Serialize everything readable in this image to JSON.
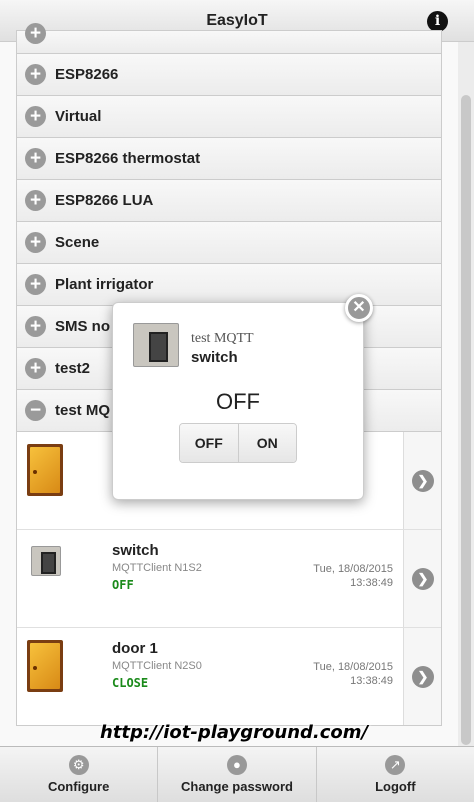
{
  "header": {
    "title": "EasyIoT",
    "info_icon": "info-icon"
  },
  "categories": [
    {
      "label": ""
    },
    {
      "label": "ESP8266"
    },
    {
      "label": "Virtual"
    },
    {
      "label": "ESP8266 thermostat"
    },
    {
      "label": "ESP8266 LUA"
    },
    {
      "label": "Scene"
    },
    {
      "label": "Plant irrigator"
    },
    {
      "label": "SMS no"
    },
    {
      "label": "test2"
    },
    {
      "label": "test MQ"
    }
  ],
  "devices": [
    {
      "icon": "door-icon",
      "name": "",
      "client": "",
      "state": "",
      "time1": "",
      "time2": ""
    },
    {
      "icon": "switch-icon",
      "name": "switch",
      "client": "MQTTClient N1S2",
      "state": "OFF",
      "time1": "Tue, 18/08/2015",
      "time2": "13:38:49"
    },
    {
      "icon": "door-icon",
      "name": "door 1",
      "client": "MQTTClient N2S0",
      "state": "CLOSE",
      "time1": "Tue, 18/08/2015",
      "time2": "13:38:49"
    }
  ],
  "popup": {
    "title": "test MQTT",
    "name": "switch",
    "state": "OFF",
    "off_label": "OFF",
    "on_label": "ON"
  },
  "watermark": "http://iot-playground.com/",
  "footer": {
    "tabs": [
      {
        "label": "Configure",
        "icon": "gear-icon"
      },
      {
        "label": "Change password",
        "icon": "lock-icon"
      },
      {
        "label": "Logoff",
        "icon": "logout-icon"
      }
    ]
  },
  "colors": {
    "state_green": "#1a8a1a"
  }
}
